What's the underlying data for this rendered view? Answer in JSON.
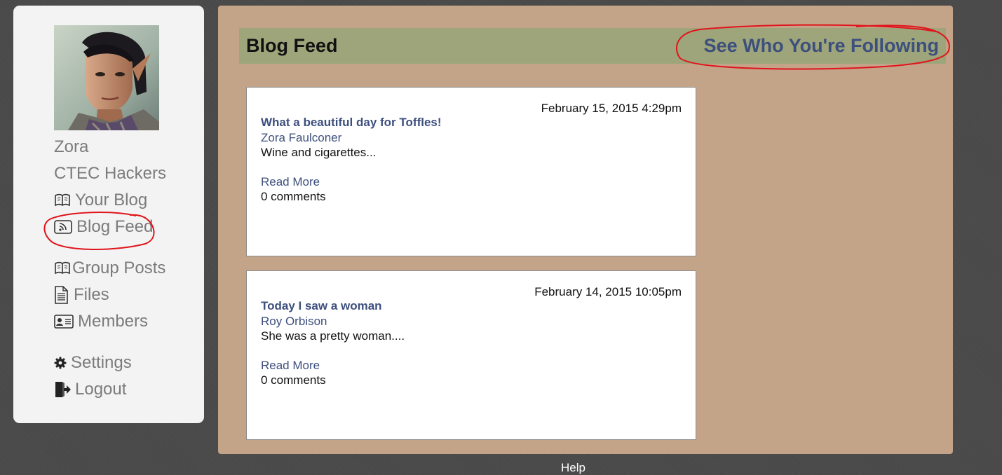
{
  "user": {
    "name": "Zora",
    "group": "CTEC Hackers"
  },
  "sidebar": {
    "items": [
      {
        "label": "Your Blog",
        "icon": "open-book-icon"
      },
      {
        "label": "Blog Feed",
        "icon": "rss-icon"
      },
      {
        "label": "Group Posts",
        "icon": "open-book-icon"
      },
      {
        "label": "Files",
        "icon": "document-icon"
      },
      {
        "label": "Members",
        "icon": "id-card-icon"
      },
      {
        "label": "Settings",
        "icon": "gear-icon"
      },
      {
        "label": "Logout",
        "icon": "logout-icon"
      }
    ]
  },
  "header": {
    "title": "Blog Feed",
    "following_link": "See Who You're Following"
  },
  "posts": [
    {
      "date": "February 15, 2015 4:29pm",
      "title": "What a beautiful day for Toffles!",
      "author": "Zora Faulconer",
      "excerpt": "Wine and cigarettes...",
      "read_more": "Read More",
      "comments": "0 comments"
    },
    {
      "date": "February 14, 2015 10:05pm",
      "title": "Today I saw a woman",
      "author": "Roy Orbison",
      "excerpt": "She was a pretty woman....",
      "read_more": "Read More",
      "comments": "0 comments"
    }
  ],
  "footer": {
    "help": "Help"
  },
  "colors": {
    "background": "#4a4a4a",
    "sidebar": "#f3f3f3",
    "main_panel": "#c4a488",
    "header_bar": "#9ea57a",
    "link": "#3d4f7d",
    "annotation": "#e0141b"
  }
}
